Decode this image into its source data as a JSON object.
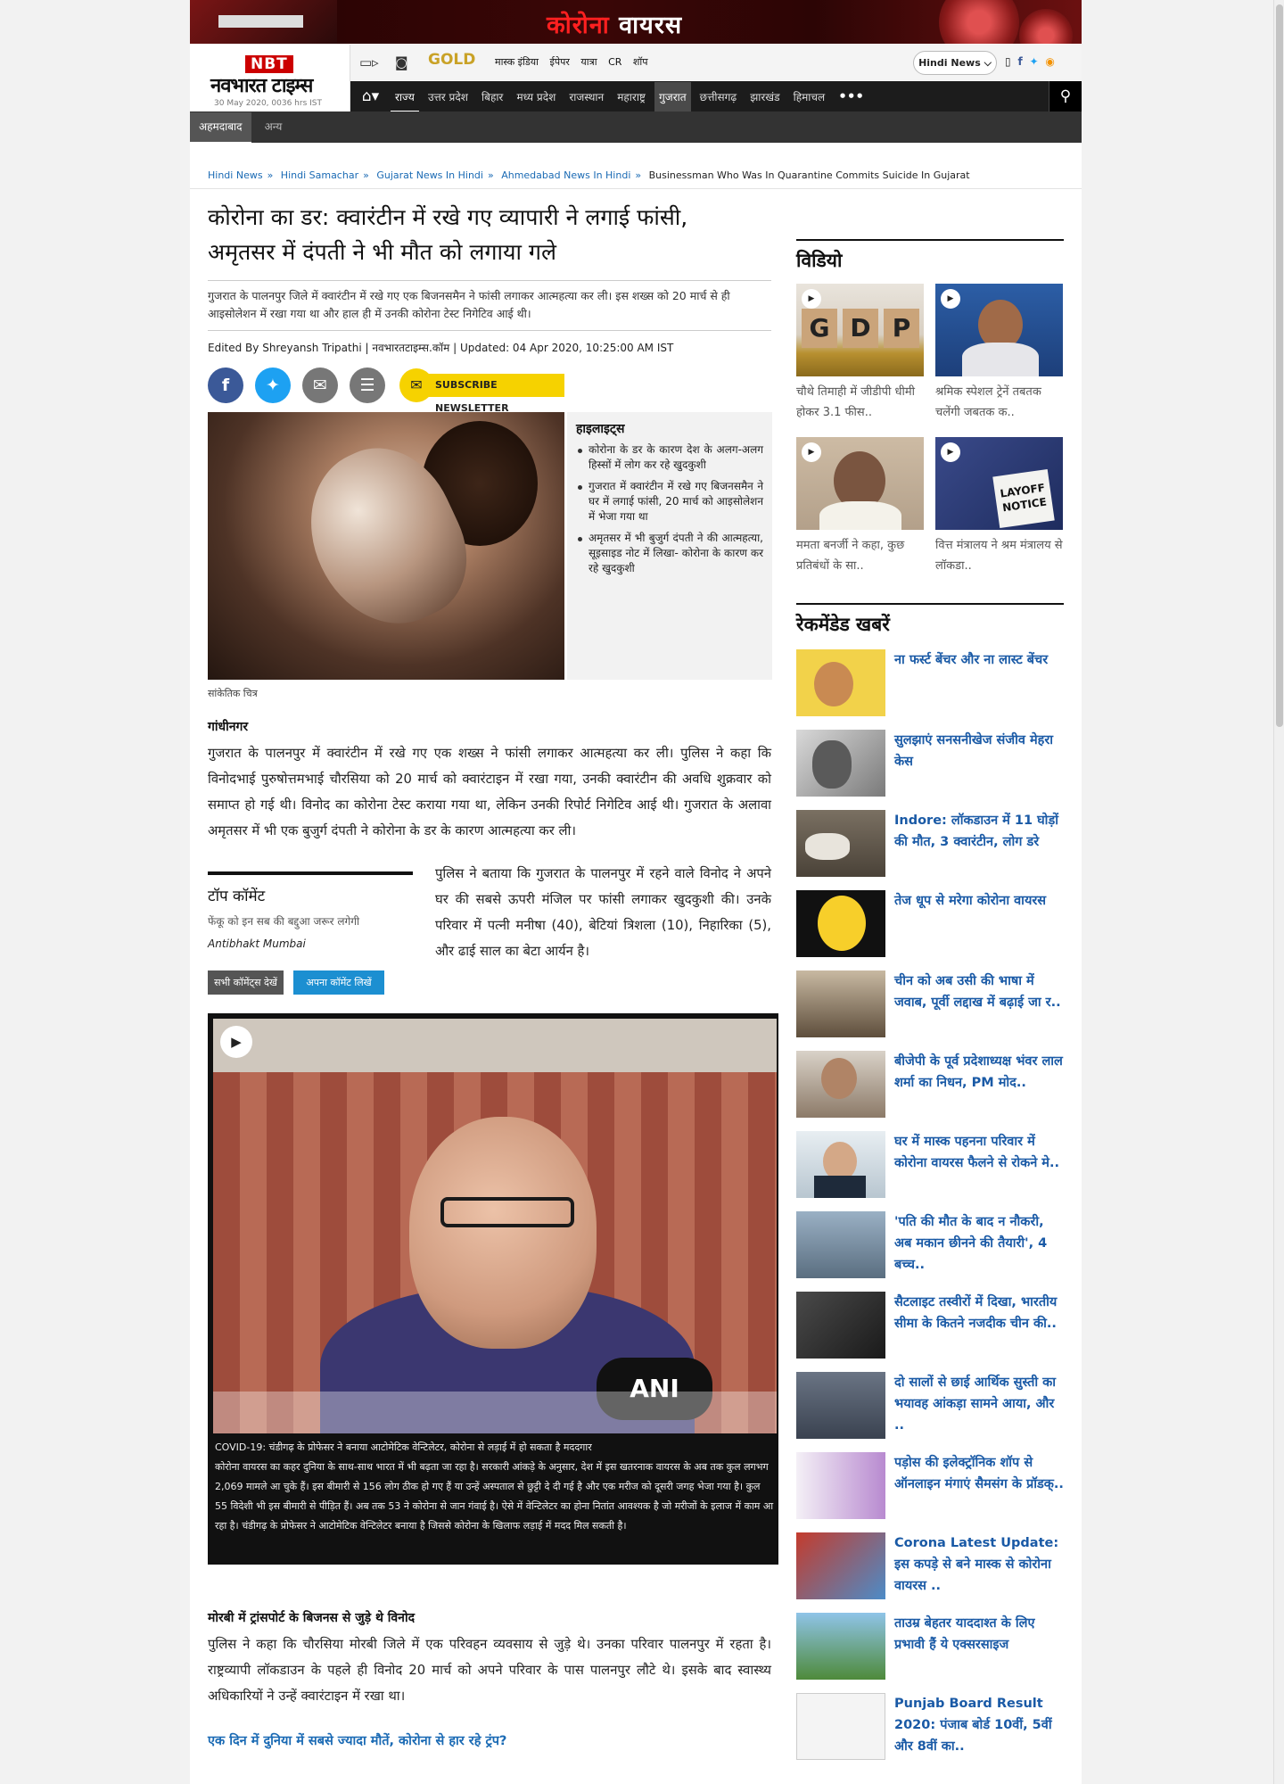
{
  "banner": {
    "title_red": "कोरोना",
    "title_white": "वायरस"
  },
  "logo": {
    "badge": "NBT",
    "name": "नवभारत टाइम्स",
    "date": "30 May 2020, 0036 hrs IST"
  },
  "util": {
    "gold": "GOLD",
    "links": [
      "मास्क इंडिया",
      "ईपेपर",
      "यात्रा",
      "CR",
      "शॉप"
    ],
    "lang_button": "Hindi News ⌵"
  },
  "nav": {
    "items": [
      "राज्य",
      "उत्तर प्रदेश",
      "बिहार",
      "मध्य प्रदेश",
      "राजस्थान",
      "महाराष्ट्र",
      "गुजरात",
      "छत्तीसगढ़",
      "झारखंड",
      "हिमाचल"
    ],
    "more": "•••"
  },
  "subnav": {
    "items": [
      "अहमदाबाद",
      "अन्य"
    ]
  },
  "breadcrumbs": {
    "items": [
      "Hindi News",
      "Hindi Samachar",
      "Gujarat News In Hindi",
      "Ahmedabad News In Hindi"
    ],
    "current": "Businessman Who Was In Quarantine Commits Suicide In Gujarat",
    "separator": "»"
  },
  "article": {
    "headline": "कोरोना का डर: क्वारंटीन में रखे गए व्यापारी ने लगाई फांसी, अमृतसर में दंपती ने भी मौत को लगाया गले",
    "summary": "गुजरात के पालनपुर जिले में क्वारंटीन में रखे गए एक बिजनसमैन ने फांसी लगाकर आत्महत्या कर ली। इस शख्स को 20 मार्च से ही आइसोलेशन में रखा गया था और हाल ही में उनकी कोरोना टेस्ट निगेटिव आई थी।",
    "byline": "Edited By Shreyansh Tripathi | नवभारतटाइम्स.कॉम | Updated: 04 Apr 2020, 10:25:00 AM IST",
    "newsletter_label": "SUBSCRIBE NEWSLETTER",
    "image_caption": "सांकेतिक चित्र",
    "highlights_title": "हाइलाइट्स",
    "highlights": [
      "कोरोना के डर के कारण देश के अलग-अलग हिस्सों में लोग कर रहे खुदकुशी",
      "गुजरात में क्वारंटीन में रखे गए बिजनसमैन ने घर में लगाई फांसी, 20 मार्च को आइसोलेशन में भेजा गया था",
      "अमृतसर में भी बुजुर्ग दंपती ने की आत्महत्या, सूइसाइड नोट में लिखा- कोरोना के कारण कर रहे खुदकुशी"
    ],
    "dateline": "गांधीनगर",
    "para1": "गुजरात के पालनपुर में क्वारंटीन में रखे गए एक शख्स ने फांसी लगाकर आत्महत्या कर ली। पुलिस ने कहा कि विनोदभाई पुरुषोत्तमभाई चौरसिया को 20 मार्च को क्वारंटाइन में रखा गया, उनकी क्वारंटीन की अवधि शुक्रवार को समाप्त हो गई थी। विनोद का कोरोना टेस्ट कराया गया था, लेकिन उनकी रिपोर्ट निगेटिव आई थी। गुजरात के अलावा अमृतसर में भी एक बुजुर्ग दंपती ने कोरोना के डर के कारण आत्महत्या कर ली।",
    "para2": "पुलिस ने बताया कि गुजरात के पालनपुर में रहने वाले विनोद ने अपने घर की सबसे ऊपरी मंजिल पर फांसी लगाकर खुदकुशी की। उनके परिवार में पत्नी मनीषा (40), बेटियां त्रिशला (10), निहारिका (5), और ढाई साल का बेटा आर्यन है।",
    "subheading": "मोरबी में ट्रांसपोर्ट के बिजनस से जुड़े थे विनोद",
    "para3": "पुलिस ने कहा कि चौरसिया मोरबी जिले में एक परिवहन व्यवसाय से जुड़े थे। उनका परिवार पालनपुर में रहता है। राष्ट्रव्यापी लॉकडाउन के पहले ही विनोद 20 मार्च को अपने परिवार के पास पालनपुर लौटे थे। इसके बाद स्वास्थ्य अधिकारियों ने उन्हें क्वारंटाइन में रखा था।",
    "related_link": "एक दिन में दुनिया में सबसे ज्यादा मौतें, कोरोना से हार रहे ट्रंप?"
  },
  "top_comment": {
    "title": "टॉप कॉमेंट",
    "comment": "फेंकू को इन सब की बद्दुआ जरूर लगेगी",
    "user": "Antibhakt Mumbai",
    "all_button": "सभी कॉमेंट्स देखें",
    "write_button": "अपना कॉमेंट लिखें"
  },
  "video": {
    "caption": "COVID-19: चंडीगढ़ के प्रोफेसर ने बनाया आटोमेटिक वेन्टिलेटर, कोरोना से लड़ाई में हो सकता है मददगार",
    "description": "कोरोना वायरस का कहर दुनिया के साथ-साथ भारत में भी बढ़ता जा रहा है। सरकारी आंकड़े के अनुसार, देश में इस खतरनाक वायरस के अब तक कुल लगभग 2,069 मामले आ चुके हैं। इस बीमारी से 156 लोग ठीक हो गए हैं या उन्हें अस्पताल से छुट्टी दे दी गई है और एक मरीज को दूसरी जगह भेजा गया है। कुल 55 विदेशी भी इस बीमारी से पीड़ित हैं। अब तक 53 ने कोरोना से जान गंवाई है। ऐसे में वेन्टिलेटर का होना नितांत आवश्यक है जो मरीजों के इलाज में काम आ रहा है। चंडीगढ़ के प्रोफेसर ने आटोमेटिक वेन्टिलेटर बनाया है जिससे कोरोना के खिलाफ लड़ाई में मदद मिल सकती है।",
    "logo": "ANI"
  },
  "sidebar": {
    "video_title": "विडियो",
    "videos": [
      {
        "title": "चौथे तिमाही में जीडीपी धीमी होकर 3.1 फीस.."
      },
      {
        "title": "श्रमिक स्पेशल ट्रेनें तबतक चलेंगी जबतक क.."
      },
      {
        "title": "ममता बनर्जी ने कहा, कुछ प्रतिबंधों के सा.."
      },
      {
        "title": "वित्त मंत्रालय ने श्रम मंत्रालय से लॉकडा.."
      }
    ],
    "gdp_letters": [
      "G",
      "D",
      "P"
    ],
    "layoff_text": "LAYOFF NOTICE",
    "recommended_title": "रेकमेंडेड खबरें",
    "recommended": [
      {
        "title": "ना फर्स्ट बेंचर और ना लास्ट बेंचर"
      },
      {
        "title": "सुलझाएं सनसनीखेज संजीव मेहरा केस"
      },
      {
        "title": "Indore: लॉकडाउन में 11 घोड़ों की मौत, 3 क्वारंटीन, लोग डरे"
      },
      {
        "title": "तेज धूप से मरेगा कोरोना वायरस"
      },
      {
        "title": "चीन को अब उसी की भाषा में जवाब, पूर्वी लद्दाख में बढ़ाई जा र.."
      },
      {
        "title": "बीजेपी के पूर्व प्रदेशाध्यक्ष भंवर लाल शर्मा का निधन, PM मोद.."
      },
      {
        "title": "घर में मास्क पहनना परिवार में कोरोना वायरस फैलने से रोकने मे.."
      },
      {
        "title": "'पति की मौत के बाद न नौकरी, अब मकान छीनने की तैयारी', 4 बच्च.."
      },
      {
        "title": "सैटलाइट तस्वीरों में दिखा, भारतीय सीमा के कितने नजदीक चीन की.."
      },
      {
        "title": "दो सालों से छाई आर्थिक सुस्ती का भयावह आंकड़ा सामने आया, और .."
      },
      {
        "title": "पड़ोस की इलेक्ट्रॉनिक शॉप से ऑनलाइन मंगाएं सैमसंग के प्रॉडक्.."
      },
      {
        "title": "Corona Latest Update: इस कपड़े से बने मास्क से कोरोना वायरस .."
      },
      {
        "title": "ताउम्र बेहतर याददाश्त के लिए प्रभावी हैं ये एक्सरसाइज"
      },
      {
        "title": "Punjab Board Result 2020: पंजाब बोर्ड 10वीं, 5वीं और 8वीं का.."
      }
    ]
  },
  "colors": {
    "brand_red": "#cc0000",
    "link_blue": "#1a5aa6",
    "nav_dark": "#1c1c1c",
    "newsletter_yellow": "#f6d200"
  }
}
